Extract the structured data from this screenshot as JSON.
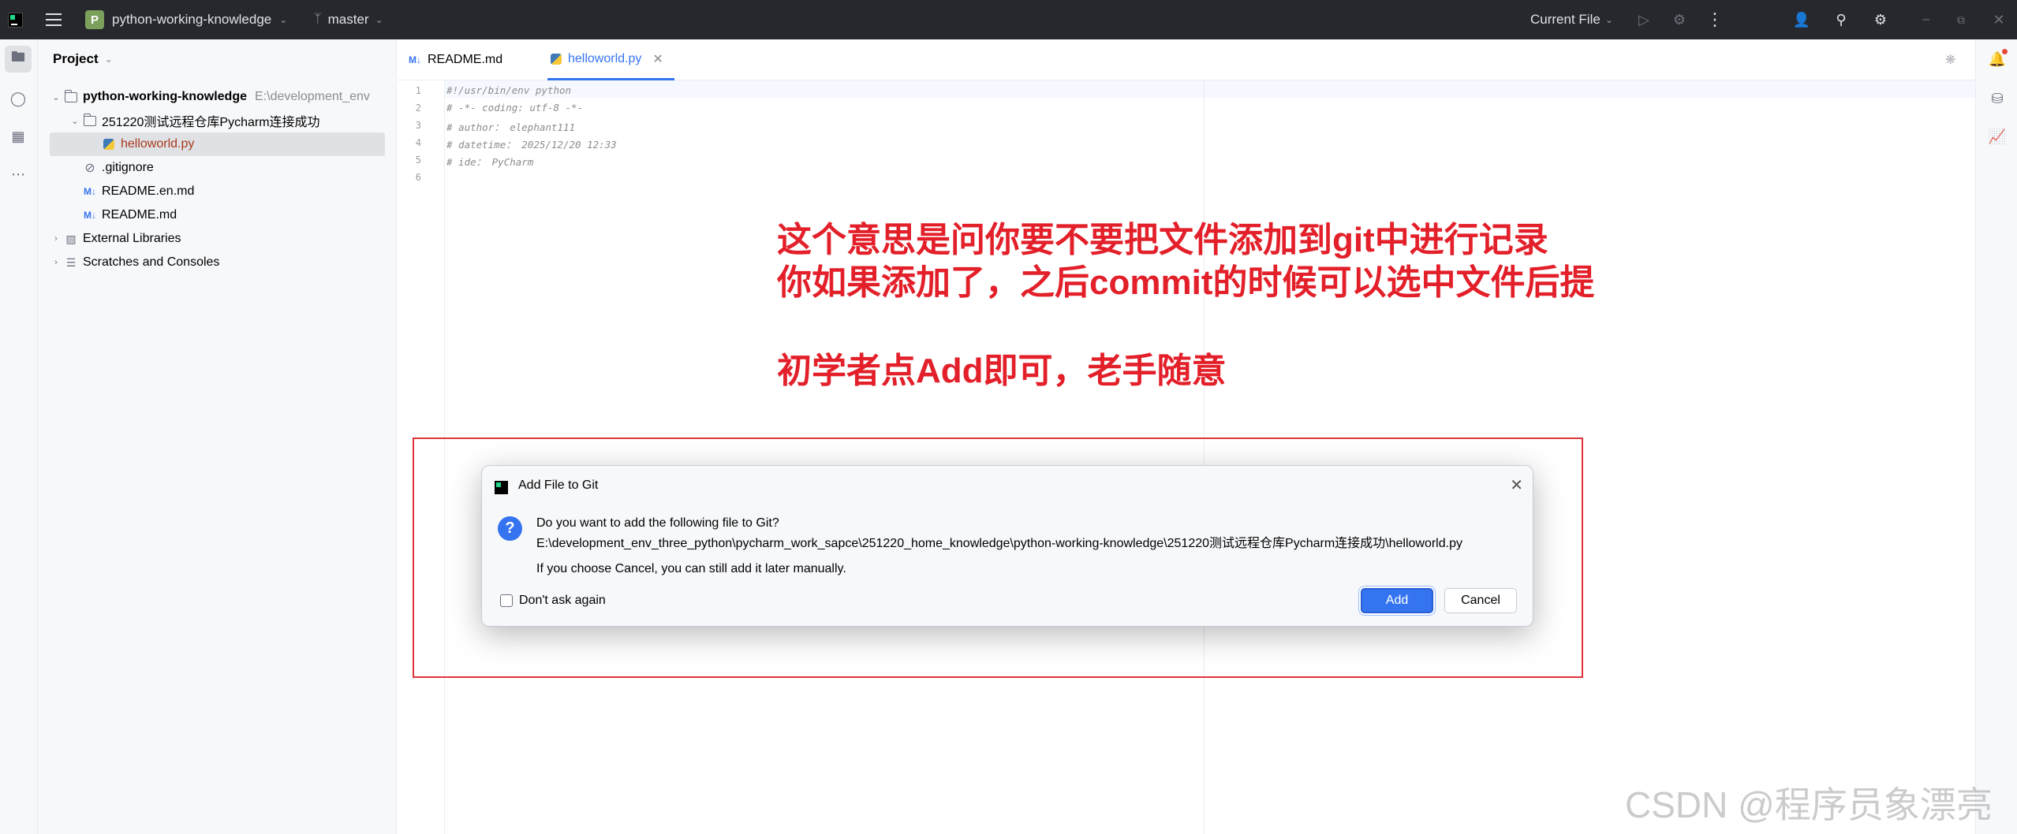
{
  "titlebar": {
    "project_badge": "P",
    "project_name": "python-working-knowledge",
    "branch": "master",
    "run_config": "Current File"
  },
  "project_panel": {
    "header": "Project",
    "tree": [
      {
        "label": "python-working-knowledge",
        "hint": "E:\\development_env"
      },
      {
        "label": "251220测试远程仓库Pycharm连接成功"
      },
      {
        "label": "helloworld.py"
      },
      {
        "label": ".gitignore"
      },
      {
        "label": "README.en.md"
      },
      {
        "label": "README.md"
      },
      {
        "label": "External Libraries"
      },
      {
        "label": "Scratches and Consoles"
      }
    ]
  },
  "editor": {
    "tabs": [
      {
        "label": "README.md"
      },
      {
        "label": "helloworld.py"
      }
    ],
    "lines": [
      {
        "n": "1",
        "text": "#!/usr/bin/env python"
      },
      {
        "n": "2",
        "text": "# -*- coding: utf-8 -*-"
      },
      {
        "n": "3",
        "text": "# author： elephant111"
      },
      {
        "n": "4",
        "text": "# datetime： 2025/12/20 12:33"
      },
      {
        "n": "5",
        "text": "# ide： PyCharm"
      },
      {
        "n": "6",
        "text": ""
      }
    ]
  },
  "annotation": {
    "line1": "这个意思是问你要不要把文件添加到git中进行记录",
    "line2": "你如果添加了，之后commit的时候可以选中文件后提",
    "line3": "初学者点Add即可，老手随意"
  },
  "dialog": {
    "title": "Add File to Git",
    "question": "Do you want to add the following file to Git?",
    "path": "E:\\development_env_three_python\\pycharm_work_sapce\\251220_home_knowledge\\python-working-knowledge\\251220测试远程仓库Pycharm连接成功\\helloworld.py",
    "note": "If you choose Cancel, you can still add it later manually.",
    "checkbox_label": "Don't ask again",
    "add_label": "Add",
    "cancel_label": "Cancel"
  },
  "watermark": "CSDN @程序员象漂亮",
  "colors": {
    "accent": "#3574f0",
    "annotation_red": "#e3202a",
    "titlebar_bg": "#27282e"
  },
  "icons": [
    "pycharm-logo-icon",
    "hamburger-menu-icon",
    "branch-icon",
    "run-icon",
    "debug-icon",
    "more-icon",
    "add-user-icon",
    "search-icon",
    "settings-icon",
    "folder-icon",
    "commit-icon",
    "structure-icon",
    "python-file-icon",
    "markdown-icon",
    "notifications-icon",
    "database-icon",
    "chart-icon",
    "question-icon"
  ]
}
